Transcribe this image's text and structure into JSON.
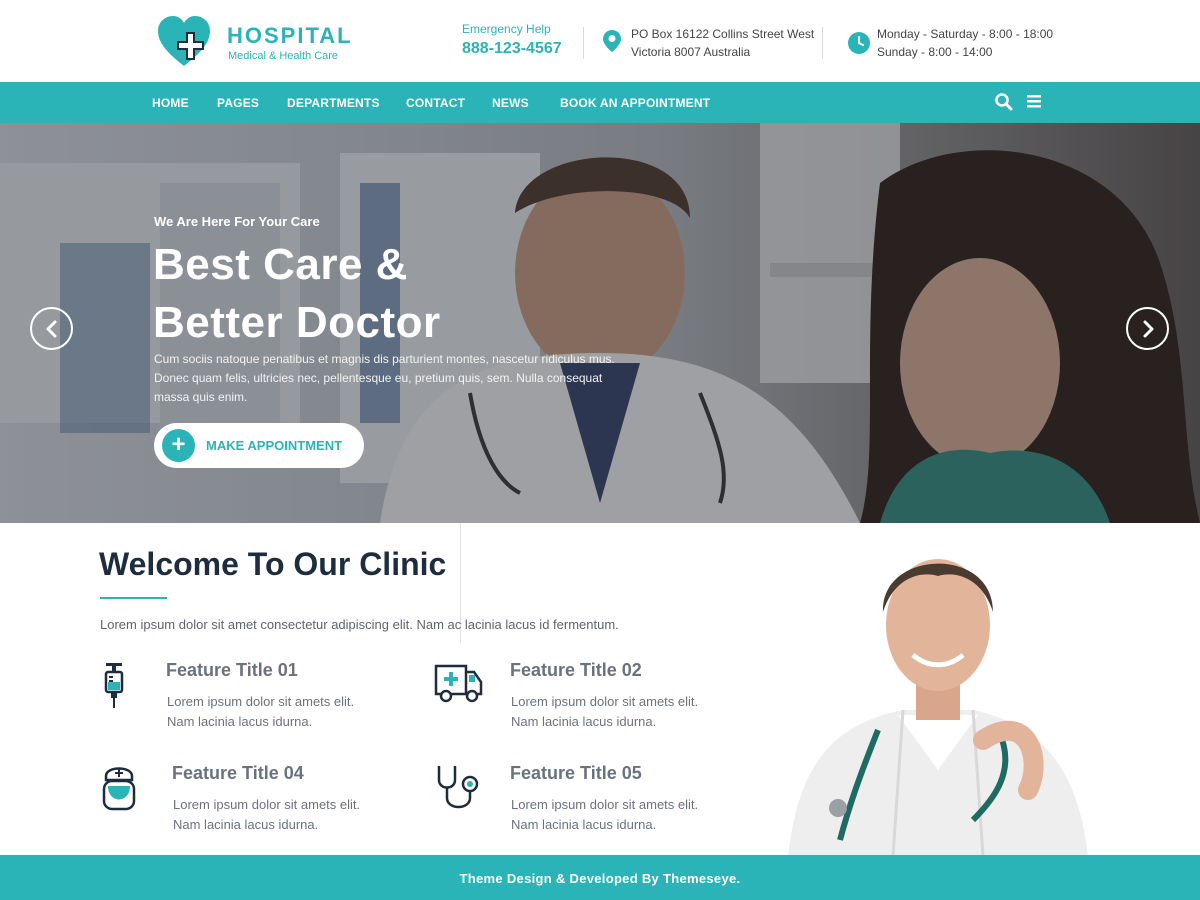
{
  "brand": {
    "name": "HOSPITAL",
    "tagline": "Medical & Health Care",
    "color": "#2ab4b8"
  },
  "header": {
    "emergency_label": "Emergency Help",
    "emergency_phone": "888-123-4567",
    "address_line1": "PO Box 16122 Collins Street West",
    "address_line2": "Victoria 8007 Australia",
    "hours_line1": "Monday - Saturday - 8:00 - 18:00",
    "hours_line2": "Sunday - 8:00 - 14:00",
    "address_icon": "map-pin-icon",
    "hours_icon": "clock-icon"
  },
  "nav": {
    "items": [
      {
        "label": "HOME"
      },
      {
        "label": "PAGES"
      },
      {
        "label": "DEPARTMENTS"
      },
      {
        "label": "CONTACT"
      },
      {
        "label": "NEWS"
      },
      {
        "label": "BOOK AN APPOINTMENT"
      }
    ],
    "search_icon": "search-icon",
    "menu_icon": "hamburger-menu-icon"
  },
  "hero": {
    "kicker": "We Are Here For Your Care",
    "title_line1": "Best Care &",
    "title_line2": "Better Doctor",
    "text": "Cum sociis natoque penatibus et magnis dis parturient montes, nascetur ridiculus mus. Donec quam felis, ultricies nec, pellentesque eu, pretium quis, sem. Nulla consequat massa quis enim.",
    "button_label": "MAKE APPOINTMENT",
    "button_icon": "plus-icon",
    "prev_icon": "chevron-left-icon",
    "next_icon": "chevron-right-icon"
  },
  "welcome": {
    "title": "Welcome To Our Clinic",
    "text": "Lorem ipsum dolor sit amet consectetur adipiscing elit. Nam ac lacinia lacus id fermentum.",
    "features": [
      {
        "title": "Feature Title 01",
        "line1": "Lorem ipsum dolor sit amets elit.",
        "line2": "Nam lacinia lacus idurna.",
        "icon": "syringe-icon"
      },
      {
        "title": "Feature Title 02",
        "line1": "Lorem ipsum dolor sit amets elit.",
        "line2": "Nam lacinia lacus idurna.",
        "icon": "ambulance-icon"
      },
      {
        "title": "Feature Title 04",
        "line1": "Lorem ipsum dolor sit amets elit.",
        "line2": "Nam lacinia lacus idurna.",
        "icon": "nurse-icon"
      },
      {
        "title": "Feature Title 05",
        "line1": "Lorem ipsum dolor sit amets elit.",
        "line2": "Nam lacinia lacus idurna.",
        "icon": "stethoscope-icon"
      }
    ]
  },
  "footer": {
    "text": "Theme Design & Developed By Themeseye."
  }
}
